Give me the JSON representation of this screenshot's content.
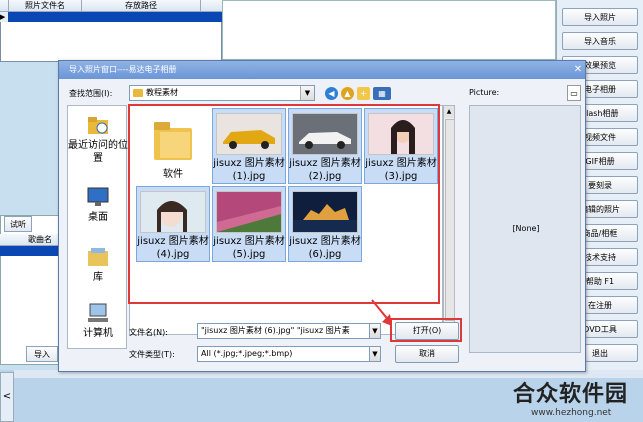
{
  "background": {
    "table_headers": [
      "照片文件名",
      "存放路径"
    ],
    "row_marker": "▶",
    "sidebar_buttons": [
      "导入照片",
      "导入音乐",
      "效果预览",
      "电子相册",
      "Flash相册",
      "视频文件",
      "GIF相册",
      "要刻录",
      "编辑的照片",
      "商品/相框",
      "技术支持",
      "帮助 F1",
      "在注册",
      "DVD工具",
      "退出"
    ],
    "lower_buttons": [
      "试听",
      "导入"
    ],
    "lower_header": "歌曲名",
    "left_arrow": "<"
  },
  "watermark": {
    "brand": "合众软件园",
    "url": "www.hezhong.net"
  },
  "dialog": {
    "title": "导入照片窗口----易达电子相册",
    "close": "✕",
    "look_in_label": "查找范围(I):",
    "look_in_value": "教程素材",
    "picture_label": "Picture:",
    "preview_none": "[None]",
    "places": [
      {
        "label": "最近访问的位置",
        "icon": "recent-places-icon"
      },
      {
        "label": "桌面",
        "icon": "desktop-icon"
      },
      {
        "label": "库",
        "icon": "libraries-icon"
      },
      {
        "label": "计算机",
        "icon": "computer-icon"
      }
    ],
    "files": [
      {
        "label": "软件",
        "kind": "folder"
      },
      {
        "label": "jisuxz 图片素材 (1).jpg",
        "kind": "car-yellow"
      },
      {
        "label": "jisuxz 图片素材 (2).jpg",
        "kind": "car-white"
      },
      {
        "label": "jisuxz 图片素材 (3).jpg",
        "kind": "woman-1"
      },
      {
        "label": "jisuxz 图片素材 (4).jpg",
        "kind": "woman-2"
      },
      {
        "label": "jisuxz 图片素材 (5).jpg",
        "kind": "field"
      },
      {
        "label": "jisuxz 图片素材 (6).jpg",
        "kind": "night-city"
      }
    ],
    "filename_label": "文件名(N):",
    "filename_value": "\"jisuxz 图片素材 (6).jpg\" \"jisuxz 图片素",
    "filetype_label": "文件类型(T):",
    "filetype_value": "All (*.jpg;*.jpeg;*.bmp)",
    "open_button": "打开(O)",
    "cancel_button": "取消"
  },
  "colors": {
    "highlight_red": "#e03838",
    "selection_blue": "#c8dcf5",
    "title_blue": "#6b95d6"
  }
}
